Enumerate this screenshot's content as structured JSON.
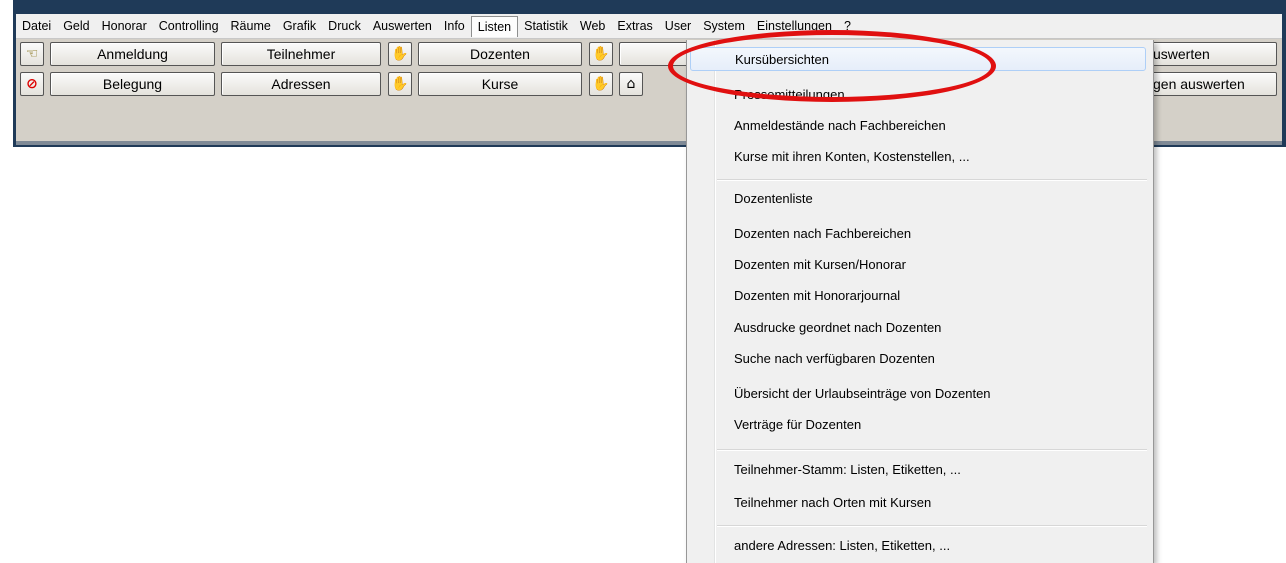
{
  "menu": [
    "Datei",
    "Geld",
    "Honorar",
    "Controlling",
    "Räume",
    "Grafik",
    "Druck",
    "Auswerten",
    "Info",
    "Listen",
    "Statistik",
    "Web",
    "Extras",
    "User",
    "System",
    "Einstellungen",
    "?"
  ],
  "active_menu": "Listen",
  "toolbar": {
    "row1": {
      "anmeldung": "Anmeldung",
      "teilnehmer": "Teilnehmer",
      "dozenten": "Dozenten",
      "auswerten_partial": "uswerten"
    },
    "row2": {
      "belegung": "Belegung",
      "adressen": "Adressen",
      "kurse": "Kurse",
      "auswerten_partial": "gen auswerten"
    }
  },
  "listen_menu": {
    "group1": [
      "Kursübersichten",
      "Pressemitteilungen",
      "Anmeldestände nach Fachbereichen",
      "Kurse mit ihren Konten, Kostenstellen, ..."
    ],
    "group2": [
      "Dozentenliste",
      "Dozenten nach Fachbereichen",
      "Dozenten mit Kursen/Honorar",
      "Dozenten mit Honorarjournal",
      "Ausdrucke geordnet nach Dozenten",
      "Suche nach verfügbaren Dozenten",
      "Übersicht der Urlaubseinträge von Dozenten",
      "Verträge für Dozenten"
    ],
    "group3": [
      "Teilnehmer-Stamm: Listen, Etiketten, ...",
      "Teilnehmer nach Orten mit Kursen"
    ],
    "group4": [
      "andere Adressen: Listen, Etiketten, ..."
    ]
  },
  "icons": {
    "row1_first": "pointing-hand-icon",
    "row2_first": "stop-icon",
    "hand": "hand-icon",
    "house": "house-icon"
  },
  "colors": {
    "annotation": "#e01010",
    "highlight_border": "#aecff7"
  }
}
